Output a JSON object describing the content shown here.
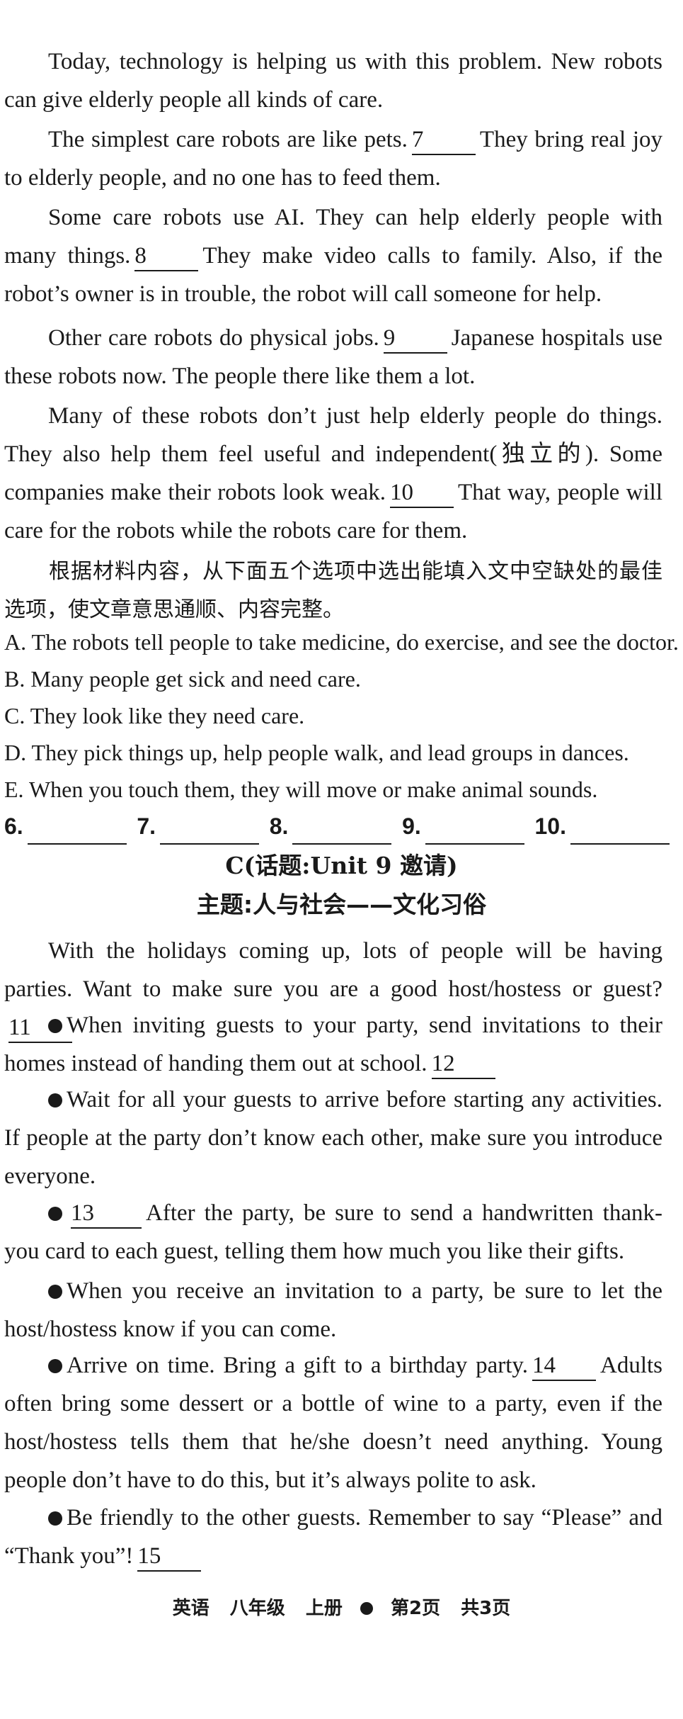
{
  "passage_b": {
    "p1": [
      "Today, technology is helping us with this problem. New robots can give elderly people all kinds of care."
    ],
    "p2": [
      "The simplest care robots are like pets.",
      "7",
      "They bring real joy to elderly people, and no one has to feed them."
    ],
    "p3": [
      "Some care robots use AI. They can help elderly people with many things.",
      "8",
      "They make video calls to family. Also, if the robot’s owner is in trouble, the robot will call someone for help."
    ],
    "p4": [
      "Other care robots do physical jobs.",
      "9",
      "Japanese hospitals use these robots now. The people there like them a lot."
    ],
    "p5": [
      "Many of these robots don’t just help elderly people do things. They also help them feel useful and independent(独立的). Some companies make their robots look weak.",
      "10",
      "That way, people will care for the robots while the robots care for them."
    ],
    "instruction": "根据材料内容，从下面五个选项中选出能填入文中空缺处的最佳选项，使文章意思通顺、内容完整。",
    "options": [
      "A. The robots tell people to take medicine, do exercise, and see the doctor.",
      "B. Many people get sick and need care.",
      "C. They look like they need care.",
      "D. They pick things up, help people walk, and lead groups in dances.",
      "E. When you touch them, they will move or make animal sounds."
    ],
    "answer_labels": [
      "6.",
      "7.",
      "8.",
      "9.",
      "10."
    ]
  },
  "section_c": {
    "title": "C(话题:Unit 9 邀请)",
    "theme": "主题:人与社会——文化习俗",
    "p1": [
      "With the holidays coming up, lots of people will be having parties. Want to make sure you are a good host/hostess or guest?",
      "11"
    ],
    "p2": [
      "When inviting guests to your party, send invitations to their homes instead of handing them out at school.",
      "12"
    ],
    "p3": [
      "Wait for all your guests to arrive before starting any activities. If people at the party don’t know each other, make sure you introduce everyone."
    ],
    "p4": [
      "13",
      "After the party, be sure to send a handwritten thank-you card to each guest, telling them how much you like their gifts."
    ],
    "p5": [
      "When you receive an invitation to a party, be sure to let the host/hostess know if you can come."
    ],
    "p6": [
      "Arrive on time. Bring a gift to a birthday party.",
      "14",
      "Adults often bring some dessert or a bottle of wine to a party, even if the host/hostess tells them that he/she doesn’t need anything. Young people don’t have to do this, but it’s always polite to ask."
    ],
    "p7": [
      "Be friendly to the other guests. Remember to say “Please” and “Thank you”!",
      "15"
    ]
  },
  "footer": {
    "subject": "英语",
    "grade": "八年级",
    "volume": "上册",
    "page": "第2页",
    "total": "共3页"
  }
}
